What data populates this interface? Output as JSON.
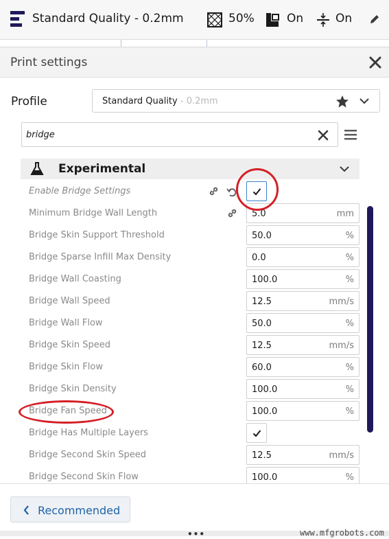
{
  "topbar": {
    "quality_label": "Standard Quality - 0.2mm",
    "infill_value": "50%",
    "support_value": "On",
    "adhesion_value": "On",
    "icons": [
      "quality-icon",
      "infill-icon",
      "support-icon",
      "adhesion-icon",
      "pencil-icon"
    ]
  },
  "panel": {
    "title": "Print settings"
  },
  "profile": {
    "label": "Profile",
    "selected_name": "Standard Quality",
    "selected_suffix": " - 0.2mm"
  },
  "search": {
    "value": "bridge"
  },
  "category": {
    "title": "Experimental",
    "icon": "flask-icon"
  },
  "settings": [
    {
      "label": "Enable Bridge Settings",
      "type": "check",
      "checked": true
    },
    {
      "label": "Minimum Bridge Wall Length",
      "value": "5.0",
      "unit": "mm"
    },
    {
      "label": "Bridge Skin Support Threshold",
      "value": "50.0",
      "unit": "%"
    },
    {
      "label": "Bridge Sparse Infill Max Density",
      "value": "0.0",
      "unit": "%"
    },
    {
      "label": "Bridge Wall Coasting",
      "value": "100.0",
      "unit": "%"
    },
    {
      "label": "Bridge Wall Speed",
      "value": "12.5",
      "unit": "mm/s"
    },
    {
      "label": "Bridge Wall Flow",
      "value": "50.0",
      "unit": "%"
    },
    {
      "label": "Bridge Skin Speed",
      "value": "12.5",
      "unit": "mm/s"
    },
    {
      "label": "Bridge Skin Flow",
      "value": "60.0",
      "unit": "%"
    },
    {
      "label": "Bridge Skin Density",
      "value": "100.0",
      "unit": "%"
    },
    {
      "label": "Bridge Fan Speed",
      "value": "100.0",
      "unit": "%"
    },
    {
      "label": "Bridge Has Multiple Layers",
      "type": "check",
      "checked": true
    },
    {
      "label": "Bridge Second Skin Speed",
      "value": "12.5",
      "unit": "mm/s"
    },
    {
      "label": "Bridge Second Skin Flow",
      "value": "100.0",
      "unit": "%"
    }
  ],
  "footer": {
    "recommended_label": "Recommended",
    "watermark": "www.mfgrobots.com"
  },
  "colors": {
    "accent_blue": "#1d63a8",
    "scrollbar": "#1e1a5a",
    "annotation_red": "#d41f26"
  }
}
